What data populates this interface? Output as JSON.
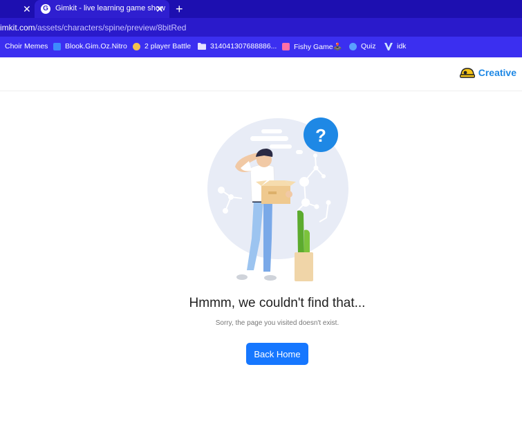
{
  "browser": {
    "tabs": [
      {
        "title": "",
        "partial": true
      },
      {
        "title": "Gimkit - live learning game show",
        "favicon": "G",
        "active": true
      }
    ],
    "url_host": "imkit.com",
    "url_path": "/assets/characters/spine/preview/8bitRed",
    "bookmarks": [
      {
        "label": "Choir Memes"
      },
      {
        "label": "Blook.Gim.Oz.Nitro"
      },
      {
        "label": "2 player Battle"
      },
      {
        "label": "314041307688886..."
      },
      {
        "label": "Fishy Game🕹️"
      },
      {
        "label": "Quiz"
      },
      {
        "label": "idk"
      }
    ]
  },
  "header": {
    "brand_label": "Creative",
    "brand_icon": "helmet-icon"
  },
  "main": {
    "heading": "Hmmm, we couldn't find that...",
    "subtext": "Sorry, the page you visited doesn't exist.",
    "back_button": "Back Home",
    "illustration_icon": "question-mark-icon",
    "illustration_symbol": "?"
  },
  "colors": {
    "tabstrip": "#1d0fb0",
    "addressbar": "#2a1acb",
    "bookmarks_bar": "#3b2ff0",
    "accent": "#1677ff",
    "brand": "#1e88e5"
  }
}
